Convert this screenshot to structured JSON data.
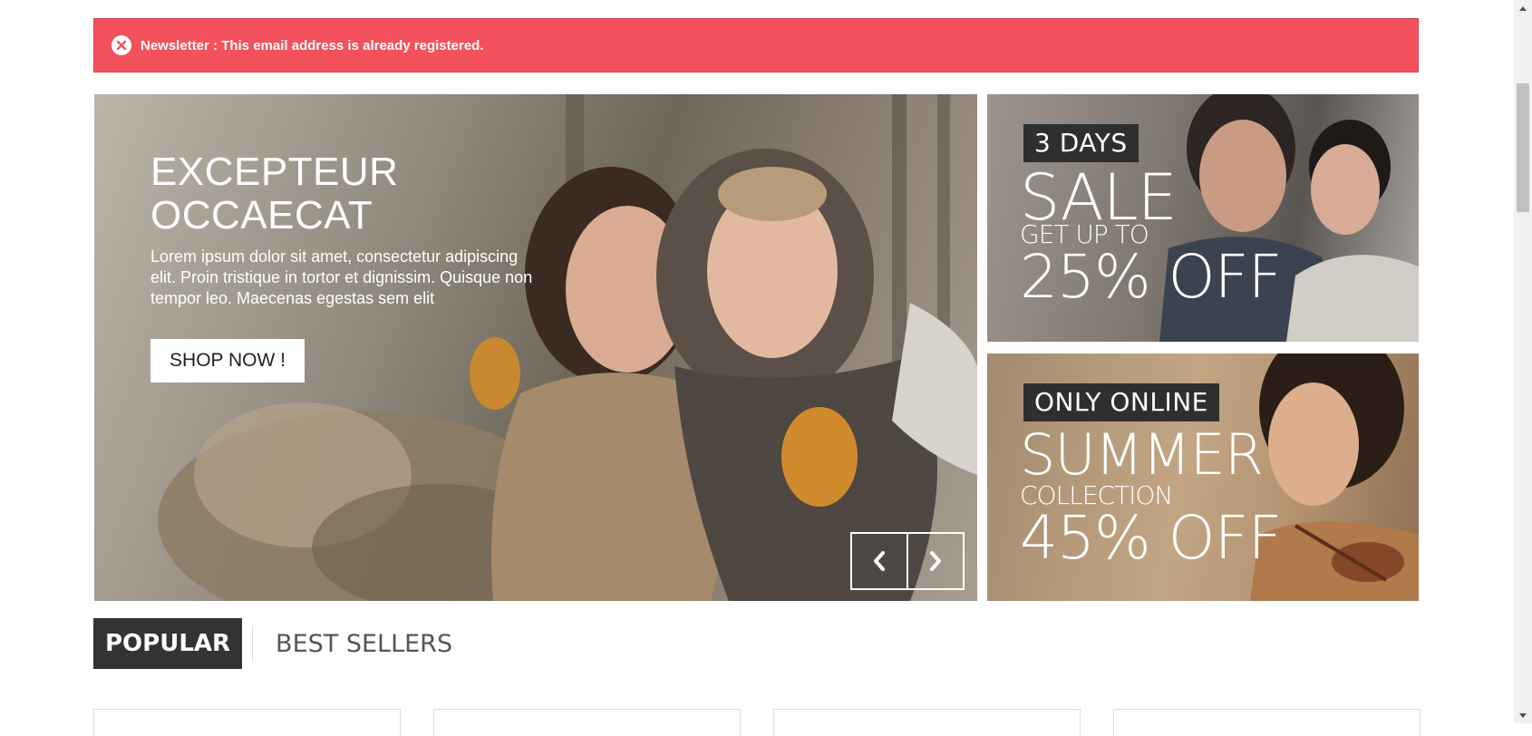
{
  "alert": {
    "message": "Newsletter : This email address is already registered.",
    "icon": "close-circle-icon",
    "color": "#f3515c"
  },
  "hero": {
    "title_line1": "EXCEPTEUR",
    "title_line2": "OCCAECAT",
    "description": "Lorem ipsum dolor sit amet, consectetur adipiscing elit. Proin tristique in tortor et dignissim. Quisque non tempor leo. Maecenas egestas sem elit",
    "button_label": "SHOP NOW !",
    "prev_icon": "chevron-left-icon",
    "next_icon": "chevron-right-icon"
  },
  "banners": [
    {
      "tag": "3 DAYS",
      "line1": "SALE",
      "line2": "GET UP TO",
      "line3": "25% OFF"
    },
    {
      "tag": "ONLY ONLINE",
      "line1": "SUMMER",
      "line2": "COLLECTION",
      "line3": "45% OFF"
    }
  ],
  "tabs": [
    {
      "label": "POPULAR",
      "active": true
    },
    {
      "label": "BEST SELLERS",
      "active": false
    }
  ]
}
